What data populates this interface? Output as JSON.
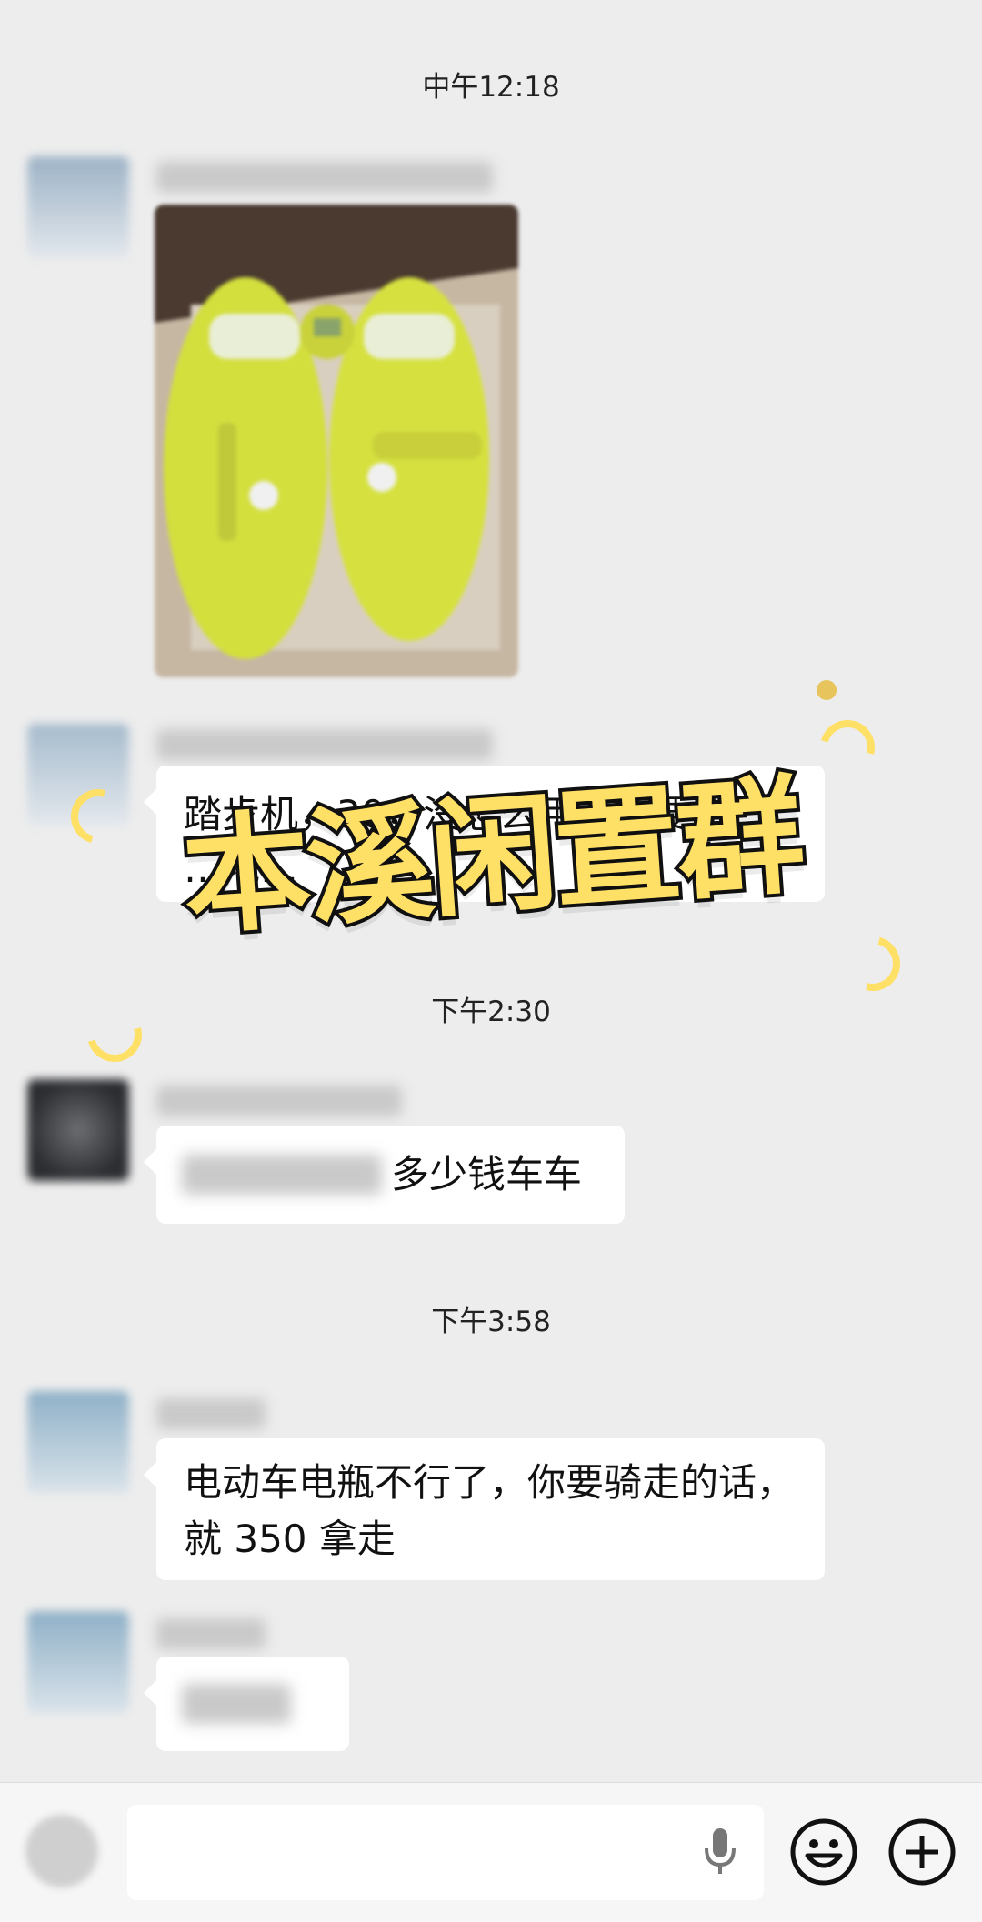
{
  "timestamps": {
    "t1": "中午12:18",
    "t2": "下午2:30",
    "t3": "下午3:58"
  },
  "messages": {
    "m2_text": "踏步机，30，没怎么用，需要",
    "m2_text2": "…地…",
    "m3_text": "多少钱车车",
    "m4_text": "电动车电瓶不行了，你要骑走的话，就 350 拿走"
  },
  "overlay": {
    "banner": "本溪闲置群"
  },
  "input": {
    "voice_icon": "microphone-icon",
    "emoji_icon": "emoji-icon",
    "plus_icon": "plus-icon"
  },
  "colors": {
    "banner_fill": "#ffe066",
    "banner_stroke": "#111111",
    "bg": "#ededed",
    "photo_yellow": "#d7e23a"
  }
}
